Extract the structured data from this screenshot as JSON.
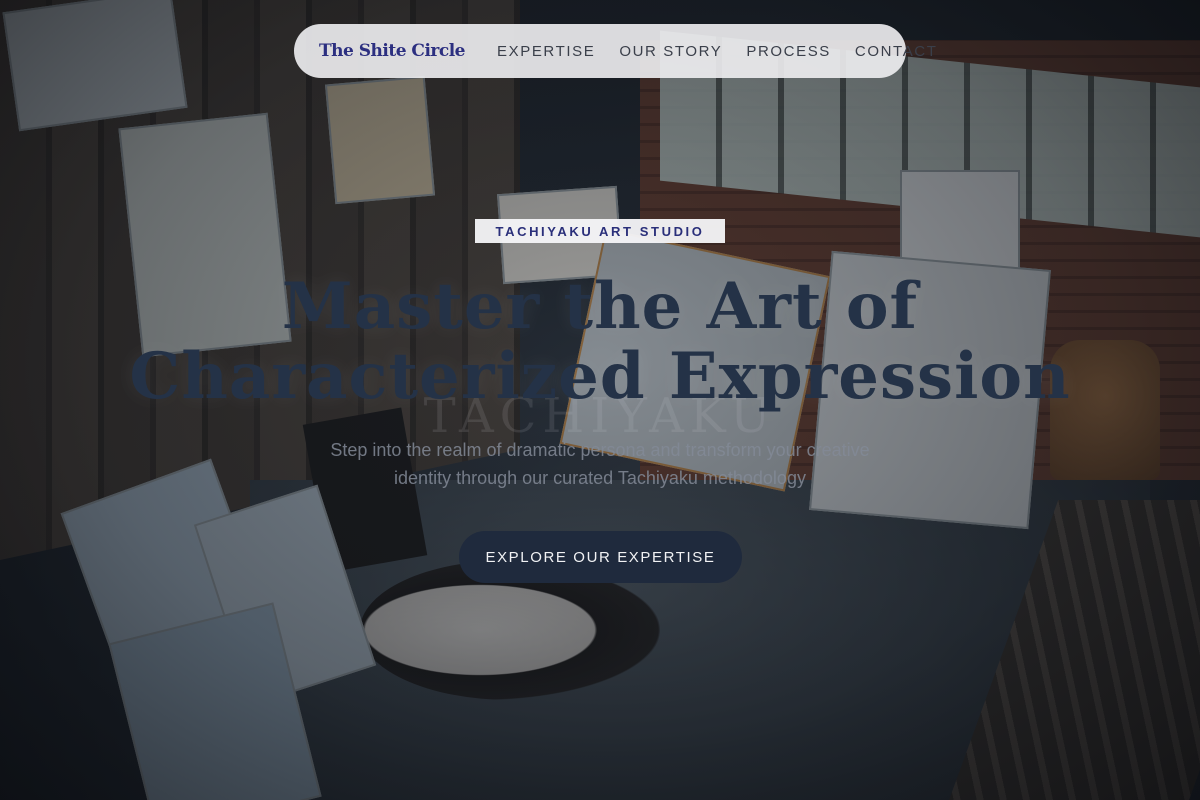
{
  "nav": {
    "brand": "The Shite Circle",
    "links": [
      "EXPERTISE",
      "OUR STORY",
      "PROCESS",
      "CONTACT"
    ]
  },
  "hero": {
    "eyebrow": "TACHIYAKU ART STUDIO",
    "headline_line1": "Master the Art of",
    "headline_line2": "Characterized Expression",
    "ghost_text": "TACHIYAKU",
    "subtitle_line1": "Step into the realm of dramatic persona and transform your creative",
    "subtitle_line2": "identity through our curated Tachiyaku methodology",
    "cta_label": "EXPLORE OUR EXPERTISE"
  },
  "colors": {
    "brand": "#2c2f80",
    "headline": "#243247",
    "cta_bg": "#1f2a3d",
    "nav_bg": "#f0f0f2"
  }
}
